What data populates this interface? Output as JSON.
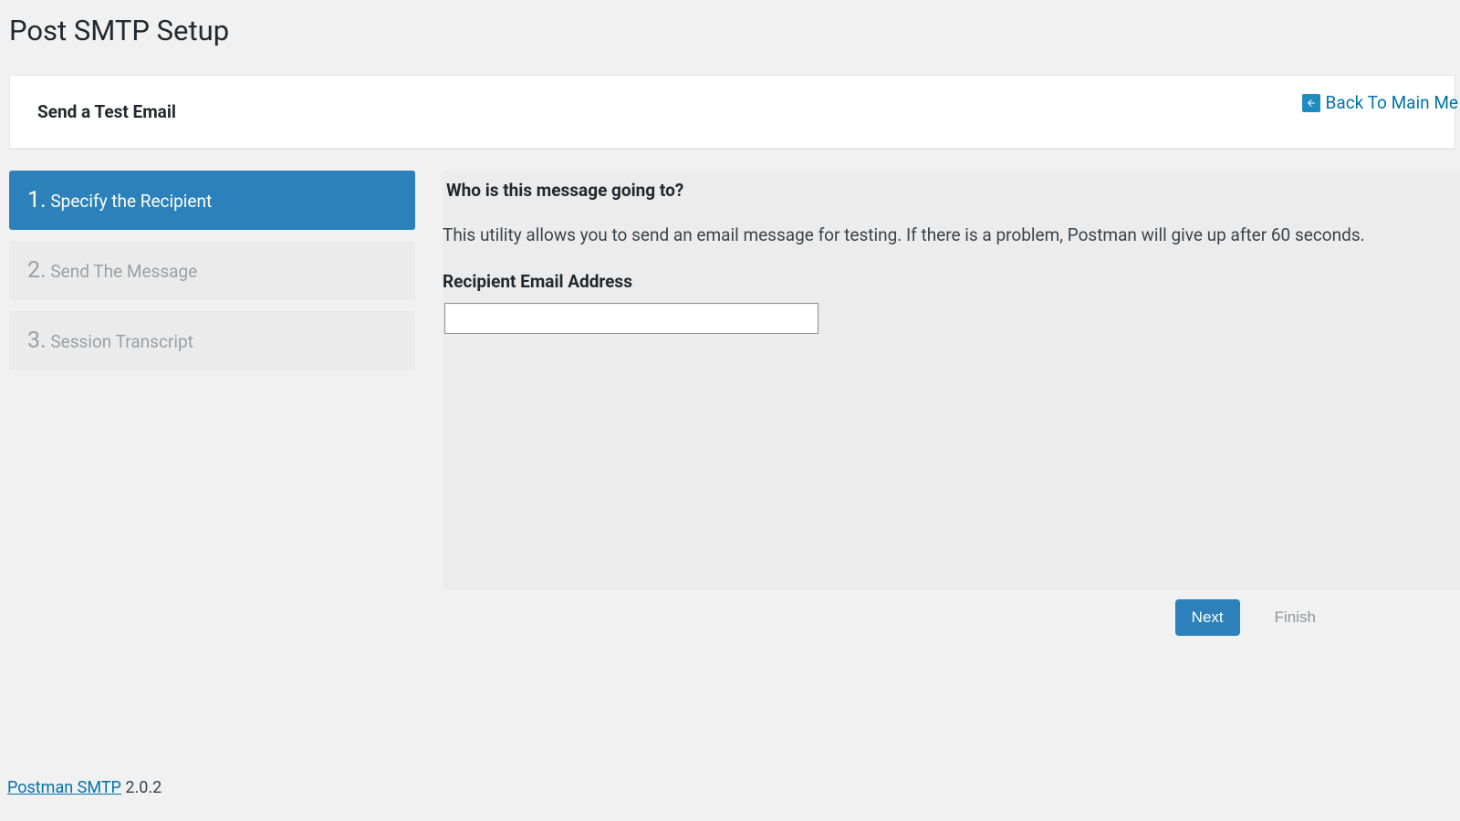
{
  "page": {
    "title": "Post SMTP Setup"
  },
  "card": {
    "title": "Send a Test Email",
    "back_link": "Back To Main Me"
  },
  "steps": [
    {
      "num": "1.",
      "label": "Specify the Recipient",
      "active": true
    },
    {
      "num": "2.",
      "label": "Send The Message",
      "active": false
    },
    {
      "num": "3.",
      "label": "Session Transcript",
      "active": false
    }
  ],
  "content": {
    "heading": "Who is this message going to?",
    "desc": "This utility allows you to send an email message for testing. If there is a problem, Postman will give up after 60 seconds.",
    "field_label": "Recipient Email Address",
    "recipient_value": ""
  },
  "buttons": {
    "next": "Next",
    "finish": "Finish"
  },
  "footer": {
    "link_text": "Postman SMTP",
    "version": " 2.0.2"
  }
}
